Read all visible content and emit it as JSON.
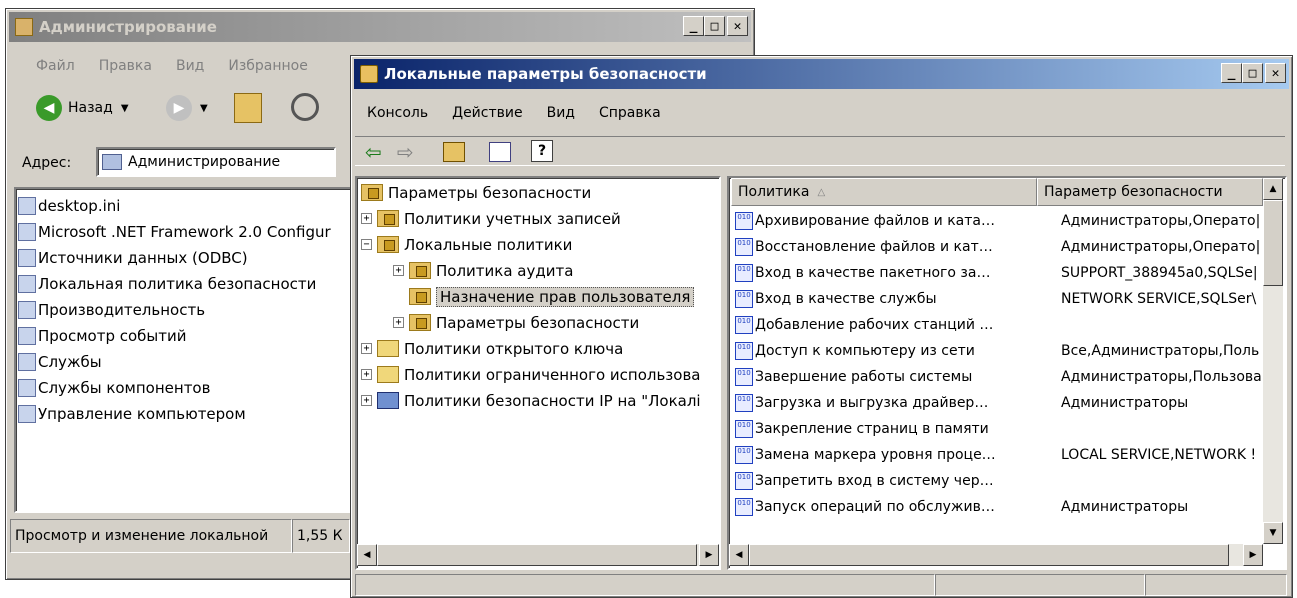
{
  "admin_window": {
    "title": "Администрирование",
    "menu": [
      "Файл",
      "Правка",
      "Вид",
      "Избранное"
    ],
    "back_label": "Назад",
    "address_label": "Адрес:",
    "address_value": "Администрирование",
    "files": [
      {
        "label": "desktop.ini",
        "icon": "ini-file-icon"
      },
      {
        "label": "Microsoft .NET Framework 2.0 Configur",
        "icon": "dotnet-config-icon"
      },
      {
        "label": "Источники данных (ODBC)",
        "icon": "odbc-icon"
      },
      {
        "label": "Локальная политика безопасности",
        "icon": "security-policy-icon"
      },
      {
        "label": "Производительность",
        "icon": "performance-icon"
      },
      {
        "label": "Просмотр событий",
        "icon": "event-viewer-icon"
      },
      {
        "label": "Службы",
        "icon": "services-icon"
      },
      {
        "label": "Службы компонентов",
        "icon": "component-services-icon"
      },
      {
        "label": "Управление компьютером",
        "icon": "computer-management-icon"
      }
    ],
    "status_text": "Просмотр и изменение локальной",
    "status_size": "1,55 К"
  },
  "sec_window": {
    "title": "Локальные параметры безопасности",
    "menu": [
      "Консоль",
      "Действие",
      "Вид",
      "Справка"
    ],
    "tree": [
      {
        "label": "Параметры безопасности",
        "level": 0,
        "expander": "",
        "icon": "security-settings-icon"
      },
      {
        "label": "Политики учетных записей",
        "level": 1,
        "expander": "+",
        "icon": "folder-lock-icon"
      },
      {
        "label": "Локальные политики",
        "level": 1,
        "expander": "-",
        "icon": "folder-lock-icon"
      },
      {
        "label": "Политика аудита",
        "level": 2,
        "expander": "+",
        "icon": "folder-lock-icon"
      },
      {
        "label": "Назначение прав пользователя",
        "level": 2,
        "expander": "",
        "icon": "folder-lock-icon",
        "selected": true
      },
      {
        "label": "Параметры безопасности",
        "level": 2,
        "expander": "+",
        "icon": "folder-lock-icon"
      },
      {
        "label": "Политики открытого ключа",
        "level": 1,
        "expander": "+",
        "icon": "folder-icon"
      },
      {
        "label": "Политики ограниченного использова",
        "level": 1,
        "expander": "+",
        "icon": "folder-icon"
      },
      {
        "label": "Политики безопасности IP на \"Локалі",
        "level": 1,
        "expander": "+",
        "icon": "ip-security-icon"
      }
    ],
    "columns": [
      "Политика",
      "Параметр безопасности"
    ],
    "rows": [
      {
        "policy": "Архивирование файлов и ката…",
        "setting": "Администраторы,Операто|"
      },
      {
        "policy": "Восстановление файлов и кат…",
        "setting": "Администраторы,Операто|"
      },
      {
        "policy": "Вход в качестве пакетного за…",
        "setting": "SUPPORT_388945a0,SQLSe|"
      },
      {
        "policy": "Вход в качестве службы",
        "setting": "NETWORK SERVICE,SQLSer\\"
      },
      {
        "policy": "Добавление рабочих станций …",
        "setting": ""
      },
      {
        "policy": "Доступ к компьютеру из сети",
        "setting": "Все,Администраторы,Поль"
      },
      {
        "policy": "Завершение работы системы",
        "setting": "Администраторы,Пользова"
      },
      {
        "policy": "Загрузка и выгрузка драйвер…",
        "setting": "Администраторы"
      },
      {
        "policy": "Закрепление страниц в памяти",
        "setting": ""
      },
      {
        "policy": "Замена маркера уровня проце…",
        "setting": "LOCAL SERVICE,NETWORK !"
      },
      {
        "policy": "Запретить вход в систему чер…",
        "setting": ""
      },
      {
        "policy": "Запуск операций по обслужив…",
        "setting": "Администраторы"
      }
    ]
  }
}
